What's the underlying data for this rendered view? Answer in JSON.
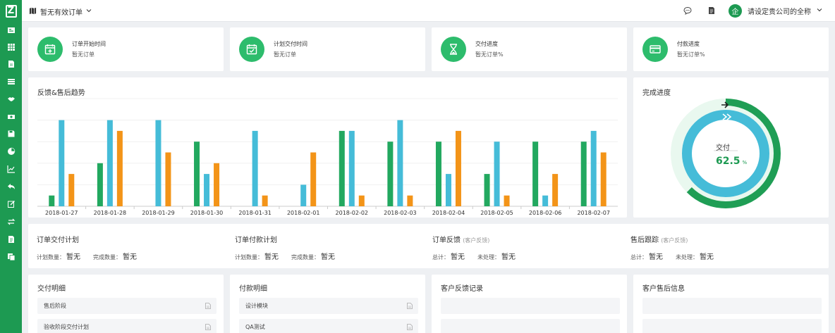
{
  "sidebar": {
    "logo": "Z",
    "icons": [
      "layout-icon",
      "grid-icon",
      "file-icon",
      "list-icon",
      "handshake-icon",
      "money-icon",
      "save-icon",
      "pie-chart-icon",
      "line-chart-icon",
      "reply-icon",
      "edit-icon",
      "exchange-icon",
      "document-icon",
      "copy-icon"
    ]
  },
  "header": {
    "project": "暂无有效订单",
    "company": "请设定贵公司的全称",
    "avatar": "企"
  },
  "stats": [
    {
      "title": "订单开始时间",
      "value": "暂无订单",
      "icon": "calendar-plus-icon"
    },
    {
      "title": "计划交付时间",
      "value": "暂无订单",
      "icon": "calendar-check-icon"
    },
    {
      "title": "交付进度",
      "value": "暂无订单%",
      "icon": "hourglass-icon"
    },
    {
      "title": "付款进度",
      "value": "暂无订单%",
      "icon": "credit-card-icon"
    }
  ],
  "trend_title": "反馈&售后趋势",
  "progress": {
    "title": "完成进度",
    "label": "交付",
    "value": "62.5",
    "unit": "%",
    "fraction": 0.625
  },
  "colors": {
    "green": "#22a85f",
    "blue": "#45bcd8",
    "orange": "#f39418",
    "accent": "#1d9a52"
  },
  "chart_data": {
    "type": "bar",
    "categories": [
      "2018-01-27",
      "2018-01-28",
      "2018-01-29",
      "2018-01-30",
      "2018-01-31",
      "2018-02-01",
      "2018-02-02",
      "2018-02-03",
      "2018-02-04",
      "2018-02-05",
      "2018-02-06",
      "2018-02-07"
    ],
    "ylim": [
      0,
      10
    ],
    "grid": true,
    "series": [
      {
        "color": "#22a85f",
        "values": [
          1,
          4,
          0,
          6,
          0,
          0,
          7,
          6,
          6,
          3,
          6,
          6
        ]
      },
      {
        "color": "#45bcd8",
        "values": [
          8,
          8,
          8,
          3,
          7,
          2,
          7,
          8,
          3,
          6,
          1,
          7
        ]
      },
      {
        "color": "#f39418",
        "values": [
          3,
          7,
          5,
          4,
          1,
          5,
          1,
          1,
          7,
          1,
          3,
          5
        ]
      }
    ]
  },
  "summary": [
    {
      "title": "订单交付计划",
      "sub": "",
      "l1": "计划数量：",
      "v1": "暂无",
      "l2": "完成数量：",
      "v2": "暂无"
    },
    {
      "title": "订单付款计划",
      "sub": "",
      "l1": "计划数量：",
      "v1": "暂无",
      "l2": "完成数量：",
      "v2": "暂无"
    },
    {
      "title": "订单反馈",
      "sub": "(客户反馈)",
      "l1": "总计：",
      "v1": "暂无",
      "l2": "未处理：",
      "v2": "暂无"
    },
    {
      "title": "售后跟踪",
      "sub": "(客户反馈)",
      "l1": "总计：",
      "v1": "暂无",
      "l2": "未处理：",
      "v2": "暂无"
    }
  ],
  "lists": [
    {
      "title": "交付明细",
      "items": [
        "售后阶段",
        "验收阶段交付计划"
      ]
    },
    {
      "title": "付款明细",
      "items": [
        "设计模块",
        "QA测试"
      ]
    },
    {
      "title": "客户反馈记录",
      "items": [
        "",
        ""
      ]
    },
    {
      "title": "客户售后信息",
      "items": [
        "",
        ""
      ]
    }
  ]
}
